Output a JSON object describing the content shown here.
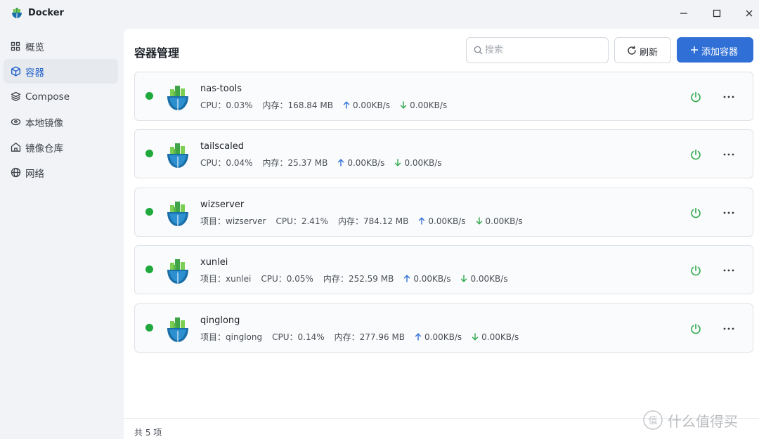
{
  "app": {
    "title": "Docker"
  },
  "window": {
    "minimize_icon": "minimize-icon",
    "maximize_icon": "maximize-icon",
    "close_icon": "close-icon"
  },
  "sidebar": {
    "items": [
      {
        "label": "概览",
        "icon": "grid-icon",
        "active": false
      },
      {
        "label": "容器",
        "icon": "cube-icon",
        "active": true
      },
      {
        "label": "Compose",
        "icon": "layers-icon",
        "active": false
      },
      {
        "label": "本地镜像",
        "icon": "disk-icon",
        "active": false
      },
      {
        "label": "镜像仓库",
        "icon": "home-icon",
        "active": false
      },
      {
        "label": "网络",
        "icon": "globe-icon",
        "active": false
      }
    ]
  },
  "main": {
    "title": "容器管理",
    "search": {
      "placeholder": "搜索",
      "value": ""
    },
    "refresh_label": "刷新",
    "add_label": "添加容器",
    "footer": "共 5 项"
  },
  "labels": {
    "cpu": "CPU：",
    "mem": "内存：",
    "project": "项目："
  },
  "containers": [
    {
      "name": "nas-tools",
      "project": null,
      "cpu": "0.03%",
      "mem": "168.84 MB",
      "up": "0.00KB/s",
      "down": "0.00KB/s",
      "status": "running"
    },
    {
      "name": "tailscaled",
      "project": null,
      "cpu": "0.04%",
      "mem": "25.37 MB",
      "up": "0.00KB/s",
      "down": "0.00KB/s",
      "status": "running"
    },
    {
      "name": "wizserver",
      "project": "wizserver",
      "cpu": "2.41%",
      "mem": "784.12 MB",
      "up": "0.00KB/s",
      "down": "0.00KB/s",
      "status": "running"
    },
    {
      "name": "xunlei",
      "project": "xunlei",
      "cpu": "0.05%",
      "mem": "252.59 MB",
      "up": "0.00KB/s",
      "down": "0.00KB/s",
      "status": "running"
    },
    {
      "name": "qinglong",
      "project": "qinglong",
      "cpu": "0.14%",
      "mem": "277.96 MB",
      "up": "0.00KB/s",
      "down": "0.00KB/s",
      "status": "running"
    }
  ],
  "colors": {
    "accent": "#2f6fd6",
    "running": "#1fa83c",
    "power": "#2ea84a",
    "upload": "#2f6fd6",
    "download": "#2ea84a"
  },
  "watermark": {
    "text": "什么值得买",
    "logo": "值"
  }
}
